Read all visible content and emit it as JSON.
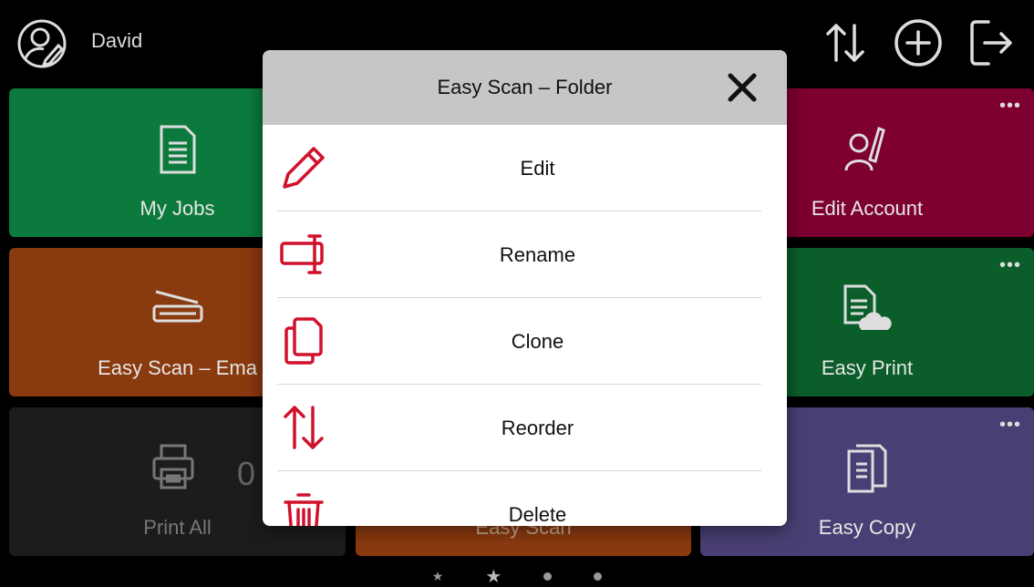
{
  "header": {
    "username": "David",
    "icons": [
      "user-edit-icon",
      "sort-icon",
      "add-icon",
      "logout-icon"
    ]
  },
  "tiles": {
    "my_jobs": "My Jobs",
    "edit_account": "Edit Account",
    "easy_scan_email": "Easy Scan – Ema",
    "easy_print": "Easy Print",
    "print_all": "Print All",
    "print_all_count": "0",
    "easy_scan": "Easy Scan",
    "easy_copy": "Easy Copy",
    "more": "•••"
  },
  "modal": {
    "title": "Easy Scan – Folder",
    "items": [
      {
        "label": "Edit",
        "icon": "pencil-icon"
      },
      {
        "label": "Rename",
        "icon": "rename-icon"
      },
      {
        "label": "Clone",
        "icon": "clone-icon"
      },
      {
        "label": "Reorder",
        "icon": "reorder-icon"
      },
      {
        "label": "Delete",
        "icon": "trash-icon"
      }
    ]
  },
  "colors": {
    "accent_red": "#d0112b",
    "tile_green": "#0b7a3c",
    "tile_maroon": "#7d0030",
    "tile_orange": "#8a3a0f",
    "tile_purple": "#4a3f74"
  }
}
